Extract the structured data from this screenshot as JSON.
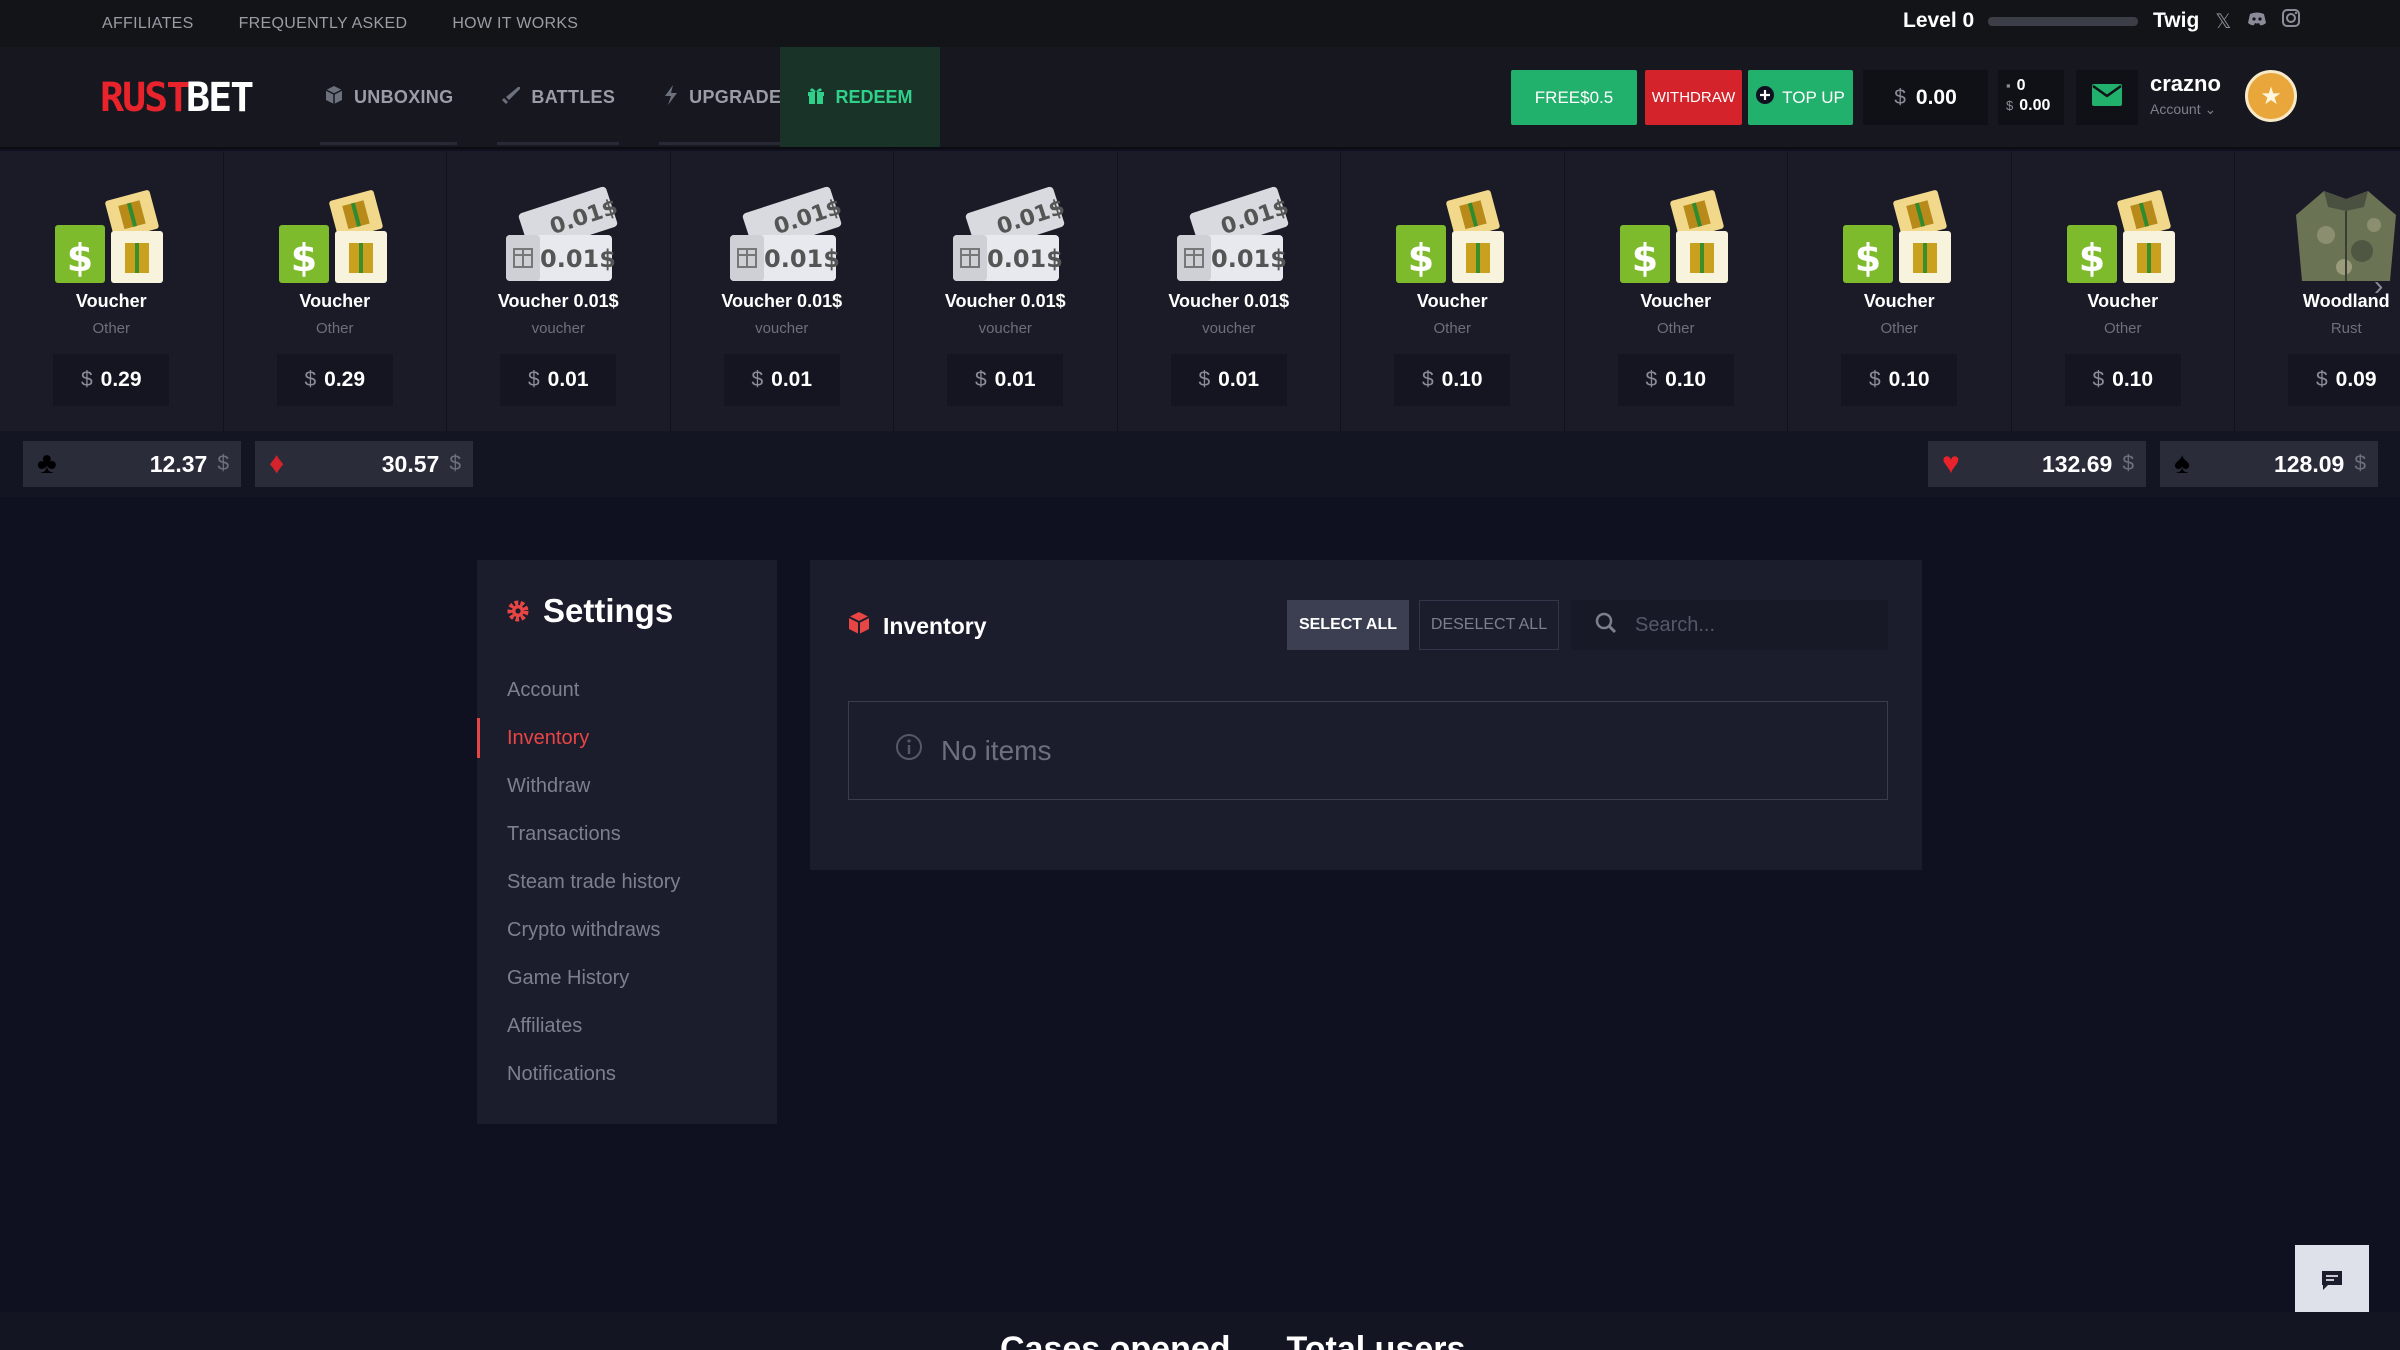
{
  "topbar": {
    "links": [
      "AFFILIATES",
      "FREQUENTLY ASKED",
      "HOW IT WORKS"
    ],
    "level_label": "Level 0",
    "level_progress": 0,
    "social_user": "Twig",
    "social_icons": [
      "x-icon",
      "discord-icon",
      "instagram-icon"
    ]
  },
  "header": {
    "logo_text": "RUSTBET",
    "nav": [
      {
        "label": "UNBOXING",
        "icon": "cube-icon"
      },
      {
        "label": "BATTLES",
        "icon": "sword-icon"
      },
      {
        "label": "UPGRADE",
        "icon": "bolt-icon"
      }
    ],
    "redeem_label": "REDEEM",
    "free_label": "FREE$0.5",
    "withdraw_label": "WITHDRAW",
    "topup_label": "TOP UP",
    "balance_currency": "$",
    "balance_value": "0.00",
    "mini_count": "0",
    "mini_value": "0.00",
    "username": "crazno",
    "account_label": "Account",
    "colors": {
      "green": "#22b06d",
      "red": "#d4232b",
      "accent_red": "#e84545"
    }
  },
  "drops": [
    {
      "name": "Voucher",
      "type": "Other",
      "price": "0.29",
      "art": "cash-gift"
    },
    {
      "name": "Voucher",
      "type": "Other",
      "price": "0.29",
      "art": "cash-gift"
    },
    {
      "name": "Voucher 0.01$",
      "type": "voucher",
      "price": "0.01",
      "art": "ticket",
      "ticket_text": "0.01$"
    },
    {
      "name": "Voucher 0.01$",
      "type": "voucher",
      "price": "0.01",
      "art": "ticket",
      "ticket_text": "0.01$"
    },
    {
      "name": "Voucher 0.01$",
      "type": "voucher",
      "price": "0.01",
      "art": "ticket",
      "ticket_text": "0.01$"
    },
    {
      "name": "Voucher 0.01$",
      "type": "voucher",
      "price": "0.01",
      "art": "ticket",
      "ticket_text": "0.01$"
    },
    {
      "name": "Voucher",
      "type": "Other",
      "price": "0.10",
      "art": "cash-gift"
    },
    {
      "name": "Voucher",
      "type": "Other",
      "price": "0.10",
      "art": "cash-gift"
    },
    {
      "name": "Voucher",
      "type": "Other",
      "price": "0.10",
      "art": "cash-gift"
    },
    {
      "name": "Voucher",
      "type": "Other",
      "price": "0.10",
      "art": "cash-gift"
    },
    {
      "name": "Woodland",
      "type": "Rust",
      "price": "0.09",
      "art": "jacket"
    }
  ],
  "drop_currency": "$",
  "suits": [
    {
      "symbol": "♣",
      "value": "12.37",
      "color": "#000000",
      "icon": "club-icon"
    },
    {
      "symbol": "♦",
      "value": "30.57",
      "color": "#d4232b",
      "icon": "diamond-icon"
    },
    {
      "symbol": "♥",
      "value": "132.69",
      "color": "#e8232b",
      "icon": "heart-icon"
    },
    {
      "symbol": "♠",
      "value": "128.09",
      "color": "#000000",
      "icon": "spade-icon"
    }
  ],
  "suit_currency": "$",
  "settings": {
    "title": "Settings",
    "menu": [
      "Account",
      "Inventory",
      "Withdraw",
      "Transactions",
      "Steam trade history",
      "Crypto withdraws",
      "Game History",
      "Affiliates",
      "Notifications"
    ],
    "active_index": 1
  },
  "inventory": {
    "title": "Inventory",
    "select_all": "SELECT ALL",
    "deselect_all": "DESELECT ALL",
    "search_placeholder": "Search...",
    "empty_text": "No items"
  },
  "footer": {
    "stats": [
      "Cases opened",
      "Total users"
    ]
  }
}
